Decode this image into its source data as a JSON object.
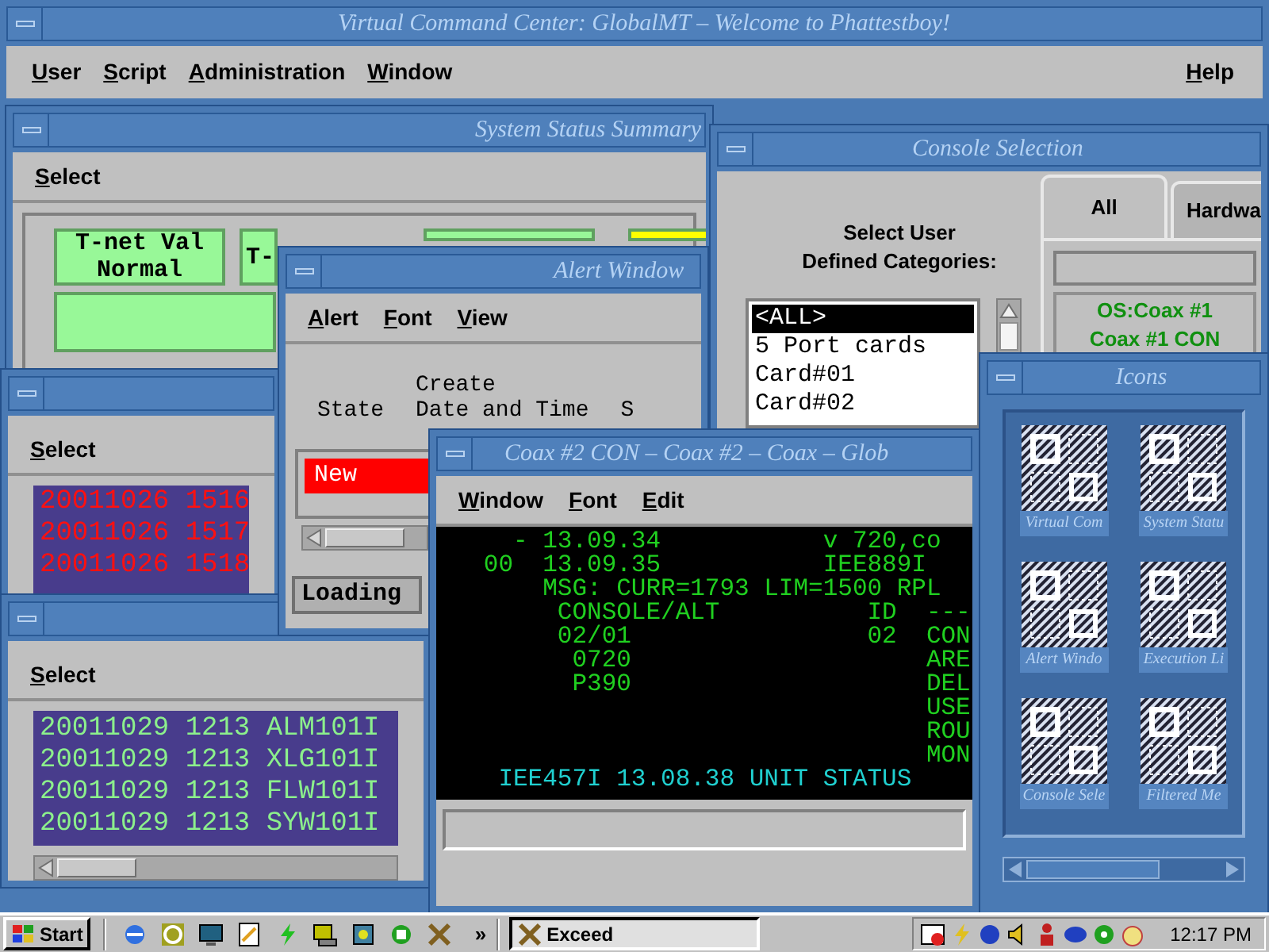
{
  "main_window": {
    "title": "Virtual Command Center: GlobalMT – Welcome to Phattestboy!",
    "menu": [
      "User",
      "Script",
      "Administration",
      "Window"
    ],
    "help": "Help"
  },
  "system_status": {
    "title": "System Status Summary",
    "menu": [
      "Select"
    ],
    "tiles": [
      {
        "kind": "status",
        "label": "T-net Val\nNormal",
        "color": "#98f898"
      },
      {
        "kind": "status",
        "label": "T-",
        "color": "#98f898"
      },
      {
        "kind": "status",
        "color": "#98f898"
      },
      {
        "kind": "status",
        "color": "#ffff00"
      },
      {
        "kind": "bar",
        "color": "#98f898"
      }
    ]
  },
  "alarm_list": {
    "menu": [
      "Select"
    ],
    "rows": [
      "20011026 1516",
      "20011026 1517",
      "20011026 1518"
    ]
  },
  "message_list": {
    "menu": [
      "Select"
    ],
    "rows": [
      "20011029 1213 ALM101I",
      "20011029 1213 XLG101I",
      "20011029 1213 FLW101I",
      "20011029 1213 SYW101I"
    ]
  },
  "alert_window": {
    "title": "Alert Window",
    "menu": [
      "Alert",
      "Font",
      "View"
    ],
    "columns": [
      "State",
      "Create\nDate and Time",
      "S"
    ],
    "rows": [
      {
        "state": "New"
      }
    ],
    "status": "Loading"
  },
  "console_selection": {
    "title": "Console Selection",
    "prompt": "Select User\nDefined Categories:",
    "categories": [
      {
        "label": "<ALL>",
        "selected": true
      },
      {
        "label": "5 Port cards",
        "selected": false
      },
      {
        "label": "Card#01",
        "selected": false
      },
      {
        "label": "Card#02",
        "selected": false
      }
    ],
    "tabs": [
      {
        "label": "All",
        "selected": true
      },
      {
        "label": "Hardwa",
        "selected": false
      }
    ],
    "consoles": [
      "OS:Coax #1\nCoax #1 CON"
    ]
  },
  "coax_window": {
    "title": "Coax #2 CON – Coax #2 – Coax – Glob",
    "menu": [
      "Window",
      "Font",
      "Edit"
    ],
    "lines": [
      {
        "text": "     - 13.09.34           v 720,co",
        "color": "#20d020"
      },
      {
        "text": "   00  13.09.35           IEE889I",
        "color": "#20d020"
      },
      {
        "text": "       MSG: CURR=1793 LIM=1500 RPL",
        "color": "#20d020"
      },
      {
        "text": "        CONSOLE/ALT          ID  ---",
        "color": "#20d020"
      },
      {
        "text": "        02/01                02  CON",
        "color": "#20d020"
      },
      {
        "text": "         0720                    ARE",
        "color": "#20d020"
      },
      {
        "text": "         P390                    DEL",
        "color": "#20d020"
      },
      {
        "text": "                                 USE",
        "color": "#20d020"
      },
      {
        "text": "                                 ROU",
        "color": "#20d020"
      },
      {
        "text": "                                 MON",
        "color": "#20d020"
      },
      {
        "text": "    IEE457I 13.08.38 UNIT STATUS",
        "color": "#20d0d0"
      }
    ]
  },
  "icons_window": {
    "title": "Icons",
    "items": [
      "Virtual Com",
      "System Statu",
      "Alert Windo",
      "Execution Li",
      "Console Sele",
      "Filtered Me"
    ]
  },
  "taskbar": {
    "start": "Start",
    "chevron": "»",
    "task": "Exceed",
    "clock": "12:17 PM"
  }
}
